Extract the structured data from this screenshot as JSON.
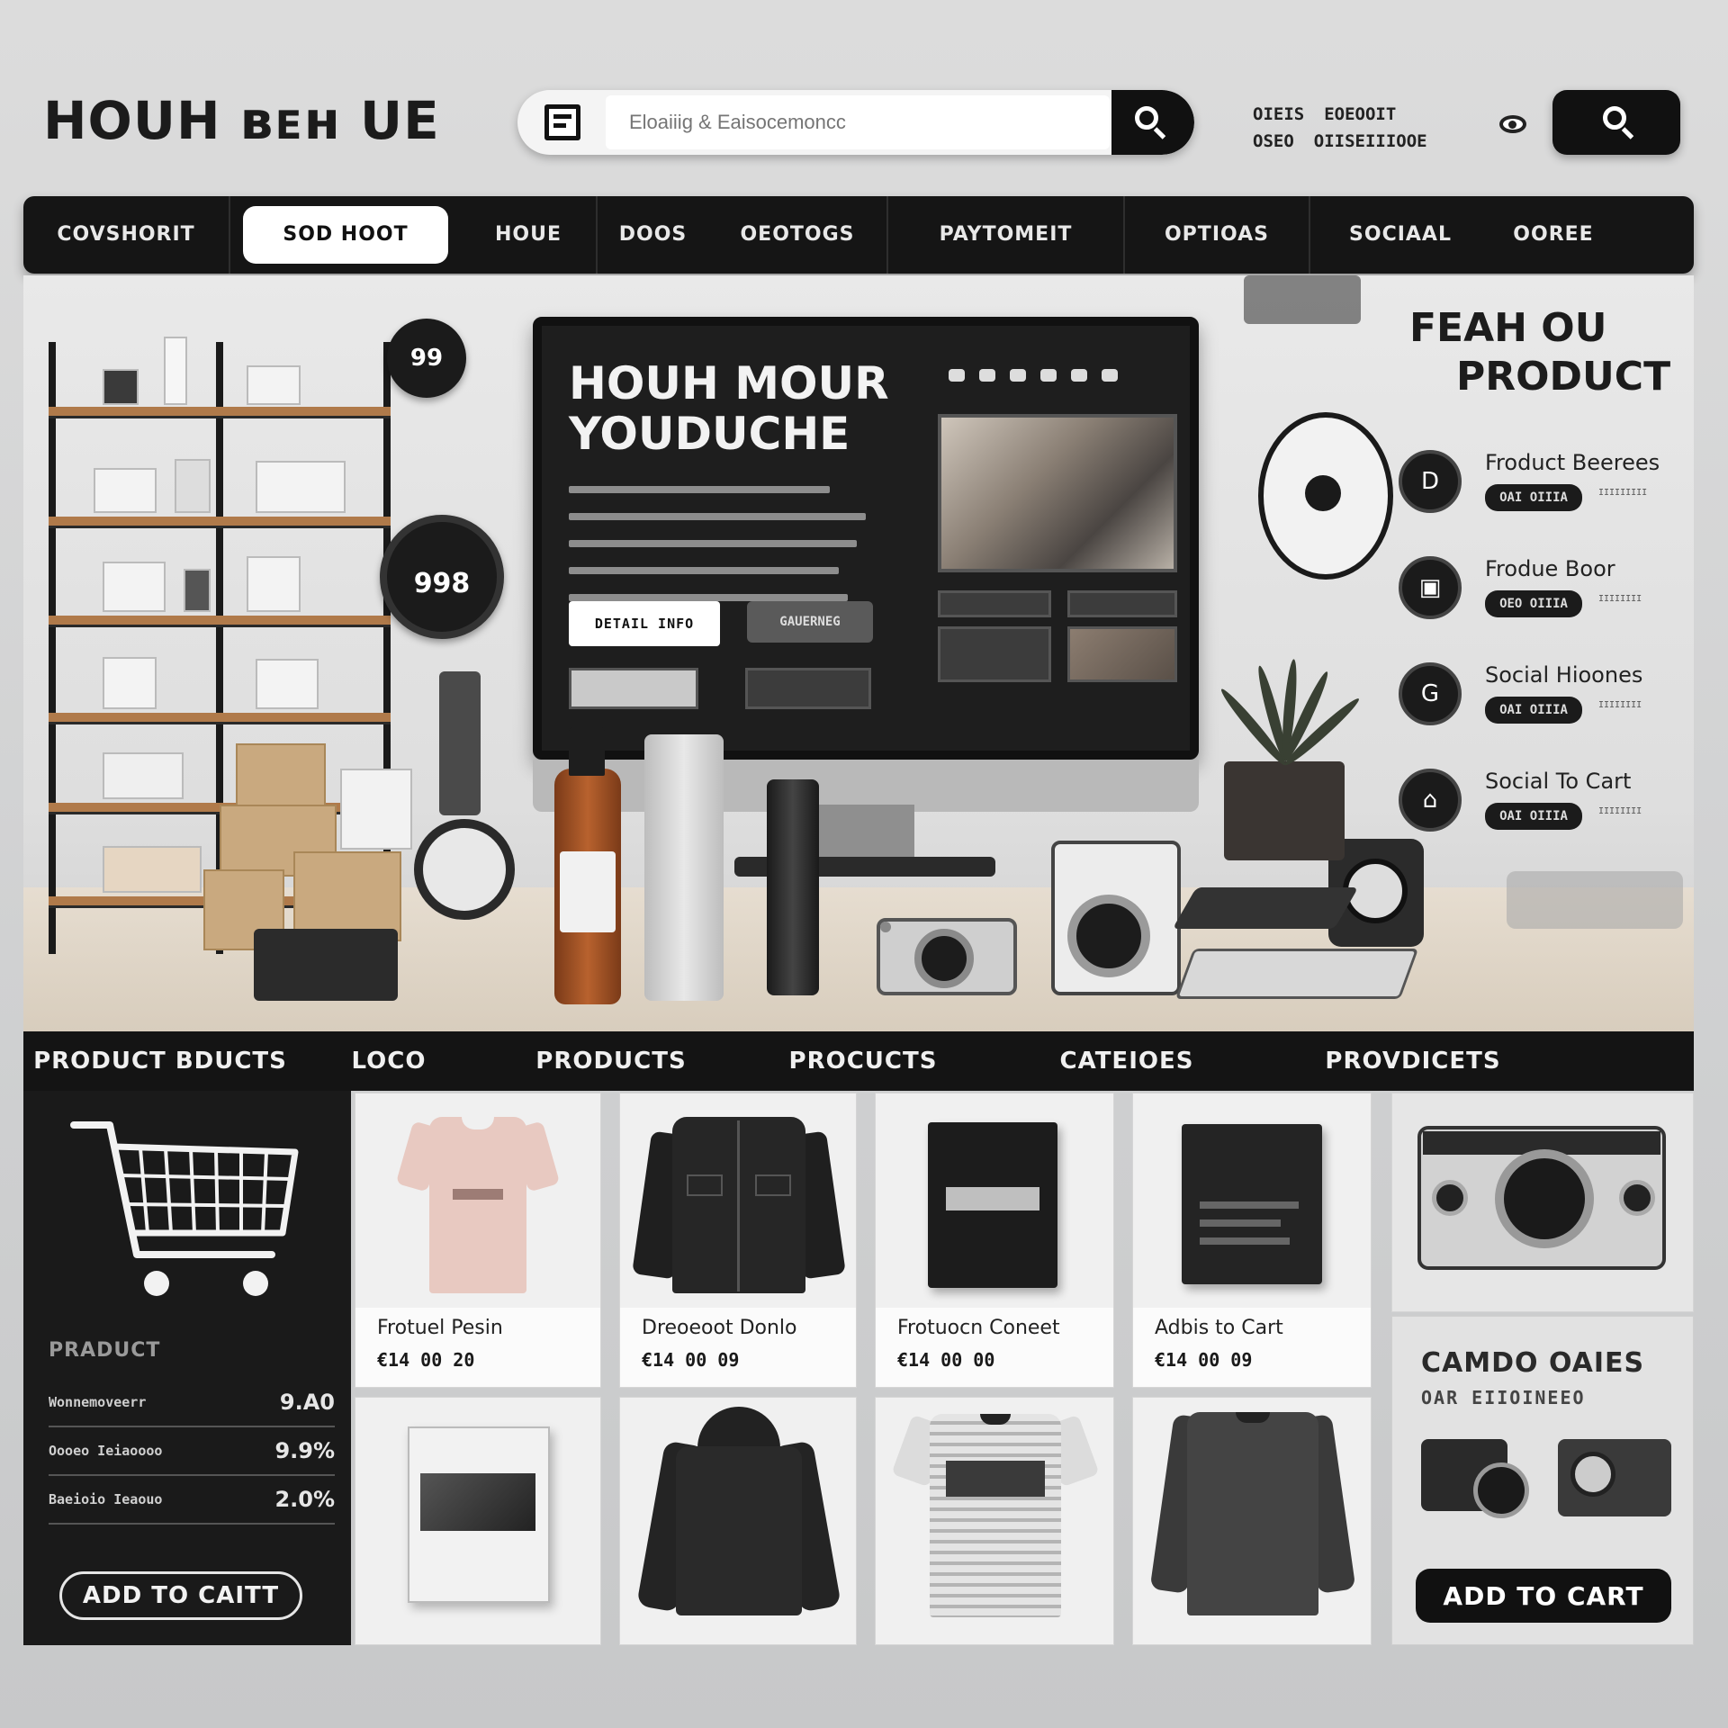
{
  "header": {
    "logo": "HOUH ʙᴇʜ UE",
    "search": {
      "placeholder": "Eloaiiig & Eaisocemoncc"
    },
    "account": {
      "line1_a": "OIEIS",
      "line1_b": "EOEOOIT",
      "line2_a": "OSEO",
      "line2_b": "OIISEIIIOOE"
    }
  },
  "nav": {
    "items": [
      {
        "label": "COVSHORIT",
        "active": false
      },
      {
        "label": "SOD HOOT",
        "active": true
      },
      {
        "label": "HOUE",
        "active": false
      },
      {
        "label": "DOOS",
        "active": false
      },
      {
        "label": "OEOTOGS",
        "active": false
      },
      {
        "label": "PAYTOMEIT",
        "active": false
      },
      {
        "label": "OPTIOAS",
        "active": false
      },
      {
        "label": "SOCIAAL",
        "active": false
      },
      {
        "label": "OOREE",
        "active": false
      }
    ]
  },
  "hero": {
    "monitor_title_1": "HOUH MOUR",
    "monitor_title_2": "YOUDUCHE",
    "btn_primary": "DETAIL INFO",
    "btn_secondary": "GAUERNEG",
    "badge_top": "99",
    "badge_mid": "998",
    "featured_title_1": "FEAH OU",
    "featured_title_2": "PRODUCT",
    "featured": [
      {
        "icon": "D",
        "label": "Froduct Beerees",
        "pill": "OAI OIIIA",
        "meta": "IIIIIIIII"
      },
      {
        "icon": "▣",
        "label": "Frodue Boor",
        "pill": "OEO OIIIA",
        "meta": "IIIIIIII"
      },
      {
        "icon": "G",
        "label": "Social Hioones",
        "pill": "OAI OIIIA",
        "meta": "IIIIIIII"
      },
      {
        "icon": "⌂",
        "label": "Social To Cart",
        "pill": "OAI OIIIA",
        "meta": "IIIIIIII"
      }
    ]
  },
  "category_bar": {
    "items": [
      "PRODUCT BDUCTS",
      "LOCO",
      "PRODUCTS",
      "PROCUCTS",
      "CATEIOES",
      "PROVDICETS"
    ]
  },
  "cart_panel": {
    "heading": "PRADUCT",
    "rows": [
      {
        "name": "Wonnemoveerr",
        "value": "9.A0"
      },
      {
        "name": "Oooeo Ieiaoooo",
        "value": "9.9%"
      },
      {
        "name": "Baeioio Ieaouo",
        "value": "2.0%"
      }
    ],
    "add_to_cart": "ADD TO CAITT"
  },
  "products": [
    {
      "name": "Frotuel Pesin",
      "price": "€14 00 20"
    },
    {
      "name": "Dreoeoot Donlo",
      "price": "€14 00 09"
    },
    {
      "name": "Frotuocn Coneet",
      "price": "€14 00 00"
    },
    {
      "name": "Adbis to Cart",
      "price": "€14 00 09"
    }
  ],
  "promo": {
    "title": "CAMDO OAIES",
    "subtitle": "OAR EIIOINEEO",
    "add_to_cart": "ADD TO CART"
  },
  "colors": {
    "dark": "#141414",
    "light_panel": "#ececec",
    "accent_wood": "#b07a4a",
    "tee_pink": "#e8c9c1"
  }
}
